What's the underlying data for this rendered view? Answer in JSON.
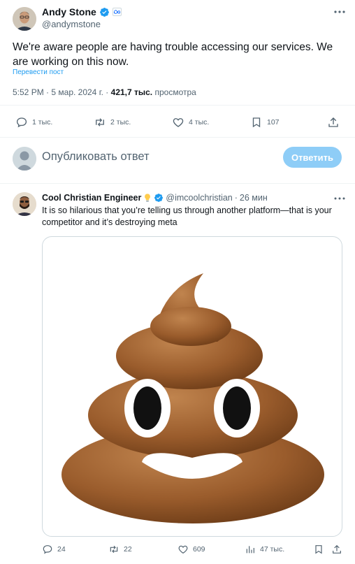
{
  "tweet": {
    "author_name": "Andy Stone",
    "author_handle": "@andymstone",
    "text": "We're aware people are having trouble accessing our services. We are working on this now.",
    "translate_label": "Перевести пост",
    "time": "5:52 PM",
    "date": "5 мар. 2024 г.",
    "views_count": "421,7 тыс.",
    "views_label": "просмотра",
    "replies": "1 тыс.",
    "reposts": "2 тыс.",
    "likes": "4 тыс.",
    "bookmarks": "107"
  },
  "compose": {
    "placeholder": "Опубликовать ответ",
    "reply_button": "Ответить"
  },
  "reply": {
    "author_name": "Cool Christian Engineer",
    "author_handle": "@imcoolchristian",
    "time_ago": "26 мин",
    "text": "It is so hilarious that you’re telling us through another platform—that is your competitor and it’s destroying meta",
    "replies": "24",
    "reposts": "22",
    "likes": "609",
    "views": "47 тыс."
  },
  "colors": {
    "accent": "#1d9bf0",
    "verified": "#1d9bf0",
    "muted": "#536471",
    "reply_button_disabled": "#8ecdf7"
  },
  "icons": [
    "more-icon",
    "verified-badge-icon",
    "meta-affiliate-icon",
    "reply-icon",
    "repost-icon",
    "like-icon",
    "bookmark-icon",
    "share-icon",
    "views-icon",
    "bulb-icon"
  ]
}
